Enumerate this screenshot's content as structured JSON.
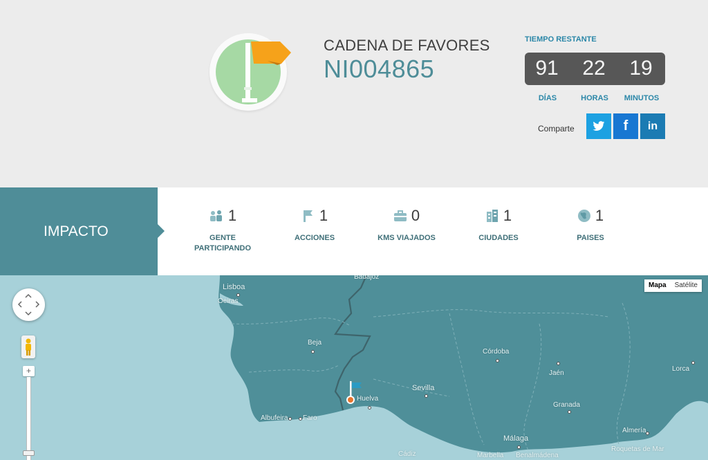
{
  "campaign": {
    "label": "CADENA DE FAVORES",
    "code": "NI004865",
    "badge_icon": "flag-icon",
    "badge_colors": {
      "ring": "#fafafa",
      "disc": "#a6d9a4",
      "flag": "#f6a21a",
      "pole": "#ffffff"
    }
  },
  "countdown": {
    "title": "TIEMPO RESTANTE",
    "days": "91",
    "hours": "22",
    "minutes": "19",
    "days_label": "DÍAS",
    "hours_label": "HORAS",
    "minutes_label": "MINUTOS"
  },
  "share": {
    "label": "Comparte",
    "buttons": [
      {
        "network": "twitter",
        "icon": "twitter-icon",
        "glyph": "",
        "color": "#1da1e2"
      },
      {
        "network": "facebook",
        "icon": "facebook-icon",
        "glyph": "f",
        "color": "#1877d2"
      },
      {
        "network": "linkedin",
        "icon": "linkedin-icon",
        "glyph": "in",
        "color": "#1b7bb3"
      }
    ]
  },
  "impact": {
    "title": "IMPACTO",
    "accent_color": "#4f8d98",
    "stats": [
      {
        "icon": "people-icon",
        "value": "1",
        "label": "GENTE PARTICIPANDO"
      },
      {
        "icon": "flag-icon",
        "value": "1",
        "label": "ACCIONES"
      },
      {
        "icon": "briefcase-icon",
        "value": "0",
        "label": "KMS VIAJADOS"
      },
      {
        "icon": "buildings-icon",
        "value": "1",
        "label": "CIUDADES"
      },
      {
        "icon": "globe-icon",
        "value": "1",
        "label": "PAISES"
      }
    ]
  },
  "map": {
    "type_buttons": [
      "Mapa",
      "Satélite"
    ],
    "selected_type": "Mapa",
    "cities": [
      "Lisboa",
      "Oeiras",
      "Badajoz",
      "Beja",
      "Córdoba",
      "Jaén",
      "Lorca",
      "Sevilla",
      "Huelva",
      "Granada",
      "Almería",
      "Faro",
      "Albufeira",
      "Málaga",
      "Marbella",
      "Benalmádena",
      "Cádiz",
      "Roquetas de Mar"
    ],
    "marker_icon": "flag-marker-icon",
    "controls": [
      "pan-icon",
      "pegman-icon",
      "zoom-in-icon"
    ]
  }
}
